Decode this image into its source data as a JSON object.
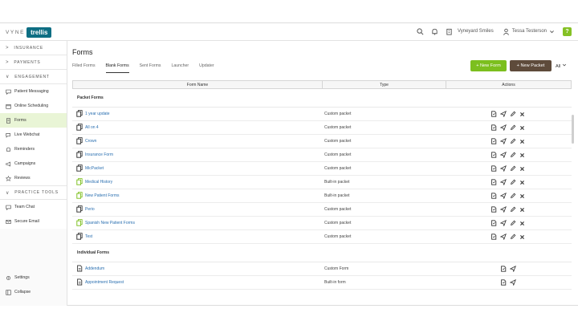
{
  "brand": {
    "prefix": "VYNE",
    "name": "trellis"
  },
  "topbar": {
    "practice": "Vyneyard Smiles",
    "user": "Tessa Testerson",
    "help": "?"
  },
  "sidebar": {
    "sections": [
      {
        "label": "INSURANCE"
      },
      {
        "label": "PAYMENTS"
      },
      {
        "label": "ENGAGEMENT"
      }
    ],
    "engagement_items": [
      {
        "label": "Patient Messaging",
        "icon": "message-icon"
      },
      {
        "label": "Online Scheduling",
        "icon": "calendar-icon"
      },
      {
        "label": "Forms",
        "icon": "forms-icon",
        "active": true
      },
      {
        "label": "Live Webchat",
        "icon": "webchat-icon"
      },
      {
        "label": "Reminders",
        "icon": "bell-icon"
      },
      {
        "label": "Campaigns",
        "icon": "megaphone-icon"
      },
      {
        "label": "Reviews",
        "icon": "star-icon"
      }
    ],
    "practice_tools": {
      "label": "PRACTICE TOOLS"
    },
    "practice_items": [
      {
        "label": "Team Chat",
        "icon": "chat-icon"
      },
      {
        "label": "Secure Email",
        "icon": "email-icon"
      }
    ],
    "bottom": [
      {
        "label": "Settings",
        "icon": "gear-icon"
      },
      {
        "label": "Collapse",
        "icon": "collapse-icon"
      }
    ]
  },
  "page": {
    "title": "Forms",
    "tabs": [
      "Filled Forms",
      "Blank Forms",
      "Sent Forms",
      "Launcher",
      "Updater"
    ],
    "active_tab": "Blank Forms",
    "new_form": "+ New Form",
    "new_packet": "+ New Packet",
    "filter": "All"
  },
  "table": {
    "headers": {
      "name": "Form Name",
      "type": "Type",
      "actions": "Actions"
    },
    "packet_group": "Packet Forms",
    "packet_rows": [
      {
        "name": "1 year update",
        "type": "Custom packet",
        "color": "#333333"
      },
      {
        "name": "All on 4",
        "type": "Custom packet",
        "color": "#333333"
      },
      {
        "name": "Crown",
        "type": "Custom packet",
        "color": "#333333"
      },
      {
        "name": "Insurance Form",
        "type": "Custom packet",
        "color": "#333333"
      },
      {
        "name": "MicPacket",
        "type": "Custom packet",
        "color": "#333333"
      },
      {
        "name": "Medical History",
        "type": "Built-in packet",
        "color": "#7cbf1e"
      },
      {
        "name": "New Patient Forms",
        "type": "Built-in packet",
        "color": "#7cbf1e"
      },
      {
        "name": "Perio",
        "type": "Custom packet",
        "color": "#333333"
      },
      {
        "name": "Spanish New Patient Forms",
        "type": "Custom packet",
        "color": "#7cbf1e"
      },
      {
        "name": "Test",
        "type": "Custom packet",
        "color": "#333333"
      }
    ],
    "individual_group": "Individual Forms",
    "individual_rows": [
      {
        "name": "Addendum",
        "type": "Custom Form"
      },
      {
        "name": "Appointment Request",
        "type": "Built-in form"
      }
    ]
  },
  "colors": {
    "accent_green": "#7cbf1e",
    "brand_teal": "#0e6e83",
    "packet_brown": "#5e4b3b",
    "link_blue": "#2a6fb0"
  }
}
